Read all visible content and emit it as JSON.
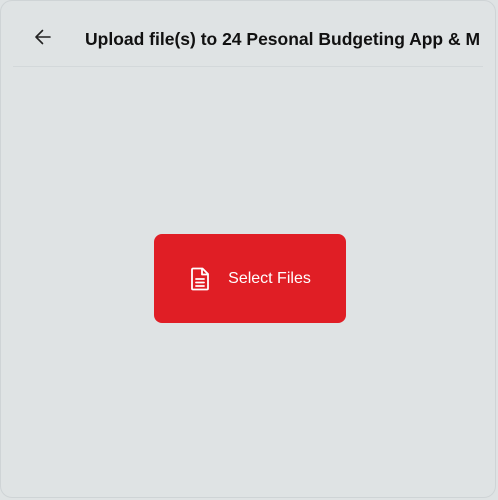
{
  "header": {
    "back_icon": "arrow-left-icon",
    "title": "Upload file(s) to 24 Pesonal Budgeting App & M"
  },
  "main": {
    "select_button": {
      "icon": "document-icon",
      "label": "Select Files",
      "color": "#e01e25"
    }
  },
  "colors": {
    "background": "#dfe3e4",
    "title": "#111111",
    "button_text": "#ffffff"
  }
}
